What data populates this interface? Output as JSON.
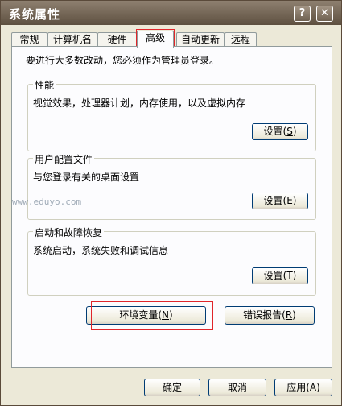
{
  "window": {
    "title": "系统属性",
    "help_button": "?",
    "close_button": "✕"
  },
  "tabs": [
    "常规",
    "计算机名",
    "硬件",
    "高级",
    "自动更新",
    "远程"
  ],
  "active_tab": "高级",
  "notice": "要进行大多数改动，您必须作为管理员登录。",
  "performance": {
    "title": "性能",
    "desc": "视觉效果，处理器计划，内存使用，以及虚拟内存",
    "button": "设置",
    "accel": "S"
  },
  "profiles": {
    "title": "用户配置文件",
    "desc": "与您登录有关的桌面设置",
    "button": "设置",
    "accel": "E"
  },
  "startup": {
    "title": "启动和故障恢复",
    "desc": "系统启动，系统失败和调试信息",
    "button": "设置",
    "accel": "T"
  },
  "env_button": {
    "label": "环境变量",
    "accel": "N"
  },
  "error_button": {
    "label": "错误报告",
    "accel": "R"
  },
  "footer": {
    "ok": "确定",
    "cancel": "取消",
    "apply": "应用",
    "apply_accel": "A"
  },
  "watermark": "www.eduyo.com",
  "colors": {
    "highlight": "#e0252a",
    "titlebar": "#6e6050",
    "dialog_bg": "#ece9d8"
  }
}
